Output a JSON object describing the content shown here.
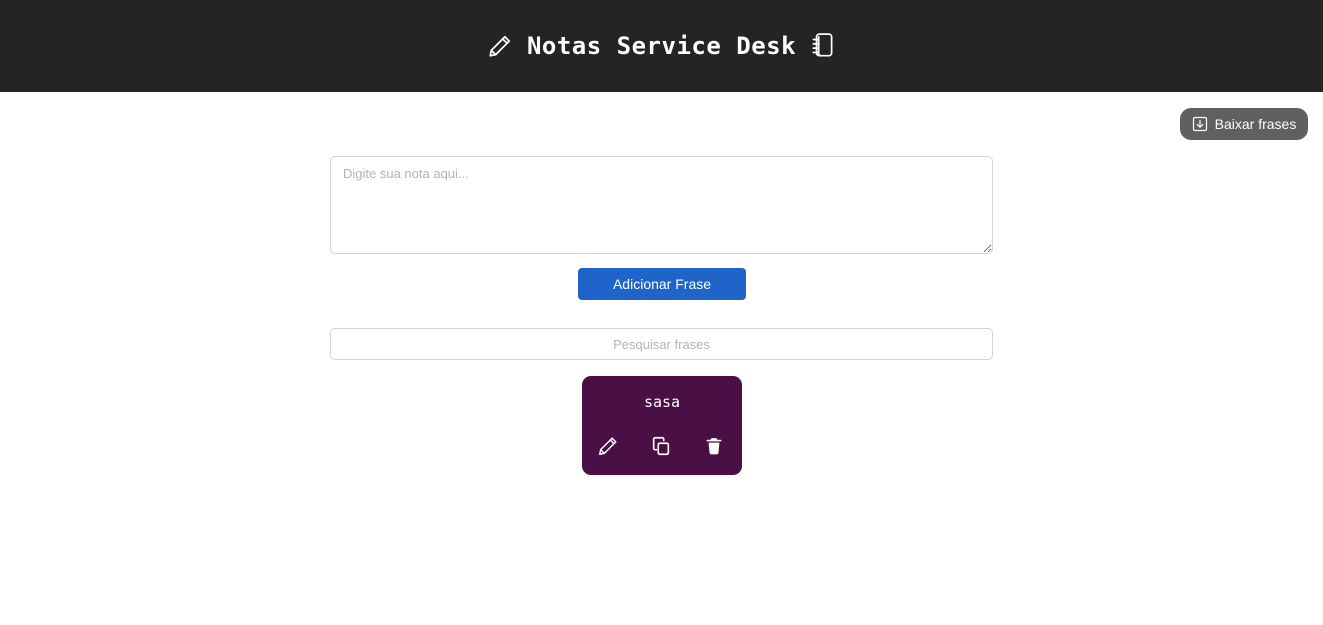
{
  "header": {
    "title": "Notas Service Desk",
    "left_icon": "pencil-icon",
    "right_icon": "notebook-icon",
    "background": "#252324"
  },
  "toolbar": {
    "download_label": "Baixar frases",
    "download_icon": "download-icon",
    "download_bg": "#606060"
  },
  "editor": {
    "note_placeholder": "Digite sua nota aqui...",
    "note_value": "",
    "add_label": "Adicionar Frase",
    "add_bg": "#1f64c8"
  },
  "search": {
    "placeholder": "Pesquisar frases",
    "value": ""
  },
  "notes": [
    {
      "text": "sasa",
      "color": "#4a0f44",
      "actions": [
        "edit-icon",
        "copy-icon",
        "trash-icon"
      ]
    }
  ]
}
